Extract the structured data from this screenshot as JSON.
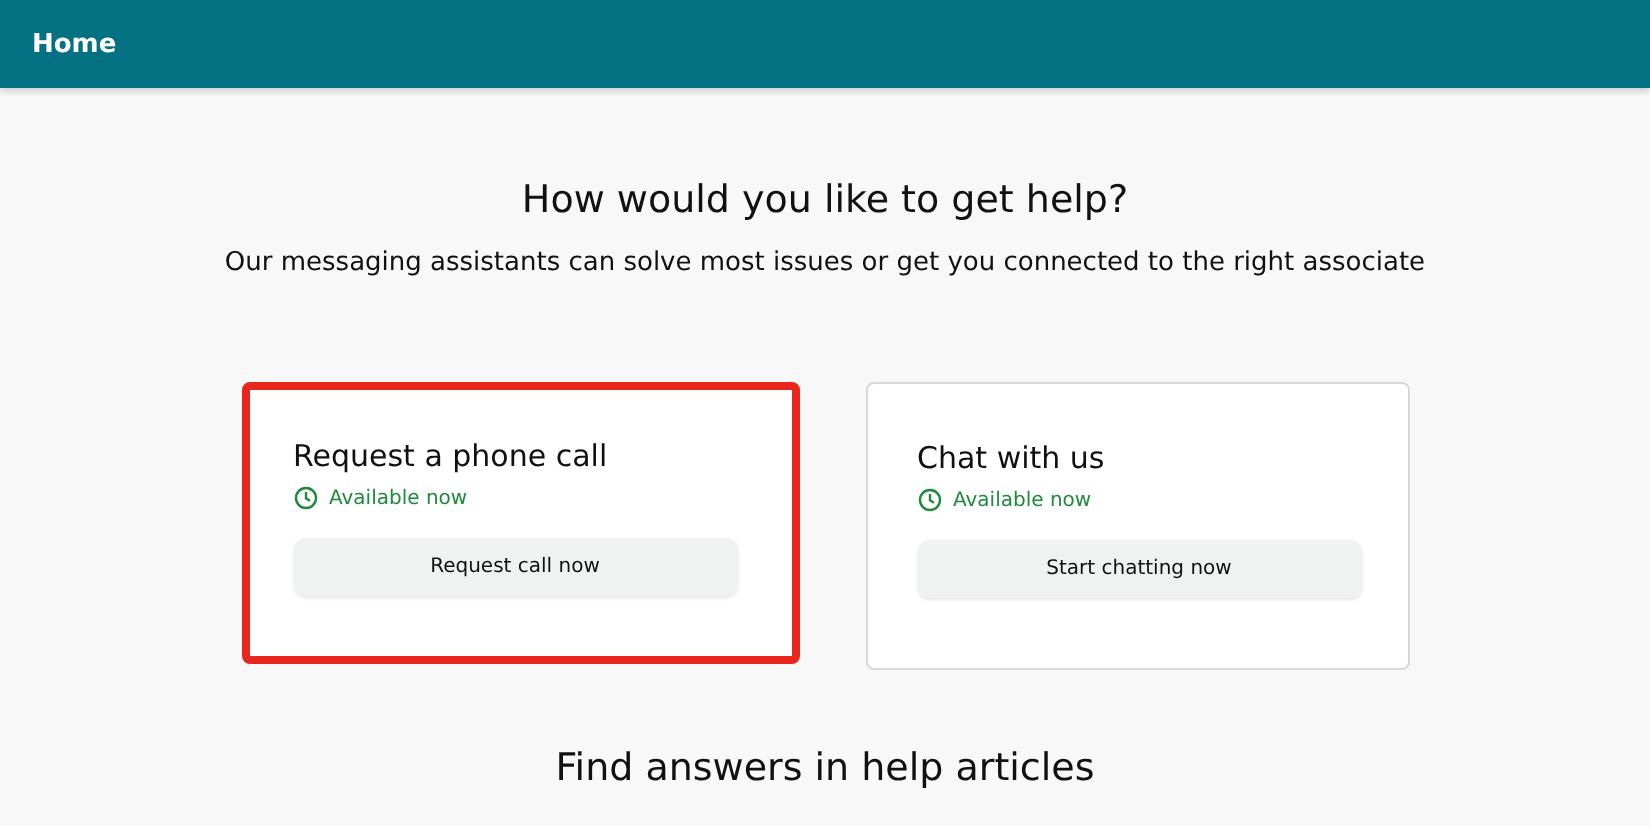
{
  "header": {
    "title": "Home"
  },
  "heading": "How would you like to get help?",
  "subtitle": "Our messaging assistants can solve most issues or get you connected to the right associate",
  "options": [
    {
      "title": "Request a phone call",
      "status": "Available now",
      "button": "Request call now",
      "highlighted": true
    },
    {
      "title": "Chat with us",
      "status": "Available now",
      "button": "Start chatting now",
      "highlighted": false
    }
  ],
  "section_heading": "Find answers in help articles"
}
